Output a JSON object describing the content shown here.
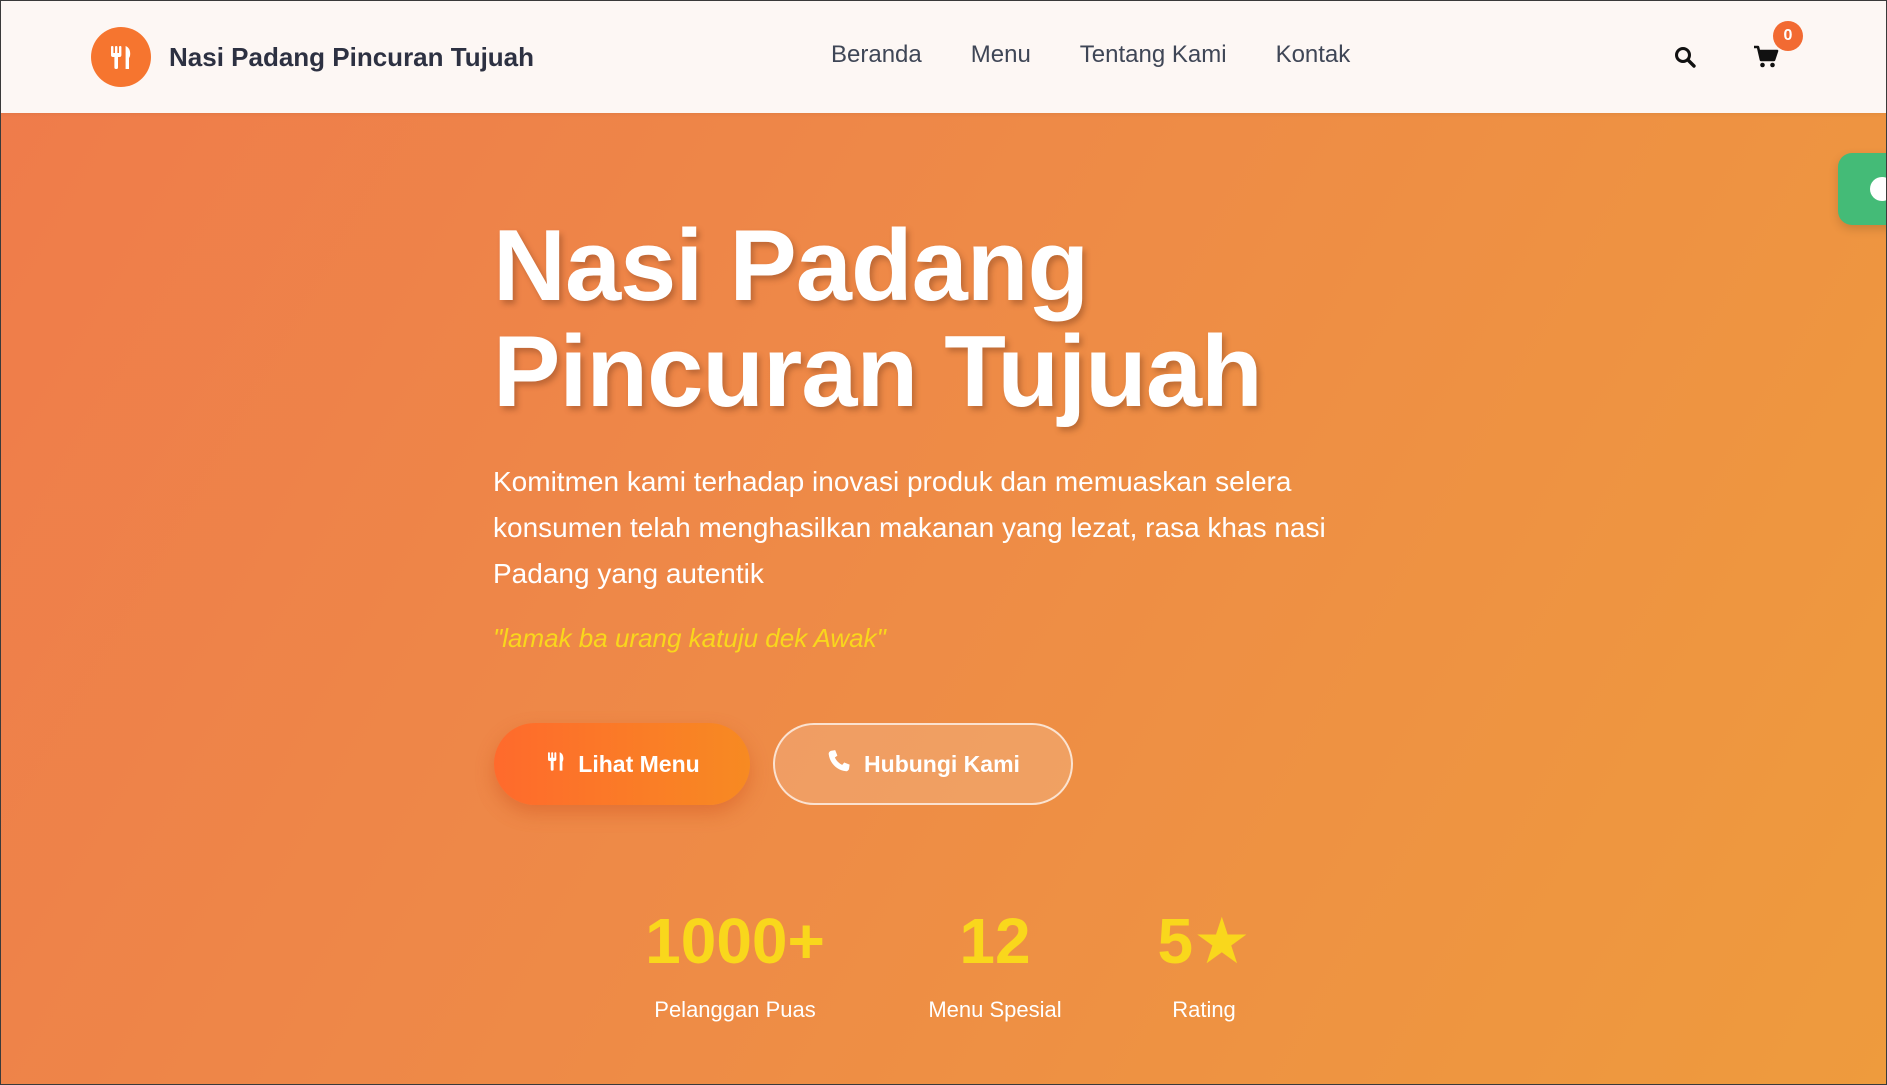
{
  "brand": {
    "name": "Nasi Padang Pincuran Tujuah",
    "logo_icon": "utensils-icon",
    "accent_color": "#f6752f"
  },
  "nav": {
    "links": [
      "Beranda",
      "Menu",
      "Tentang Kami",
      "Kontak"
    ],
    "search_icon": "search-icon",
    "cart_icon": "cart-icon",
    "cart_count": "0"
  },
  "hero": {
    "title_line1": "Nasi Padang",
    "title_line2": "Pincuran Tujuah",
    "description": "Komitmen kami terhadap inovasi produk dan memuaskan selera konsumen telah menghasilkan makanan yang lezat, rasa khas nasi Padang yang autentik",
    "quote": "\"lamak ba urang katuju dek Awak\"",
    "primary_button": "Lihat Menu",
    "secondary_button": "Hubungi Kami",
    "quote_color": "#f9d71c"
  },
  "stats": [
    {
      "value": "1000+",
      "label": "Pelanggan Puas"
    },
    {
      "value": "12",
      "label": "Menu Spesial"
    },
    {
      "value": "5★",
      "label": "Rating"
    }
  ],
  "floating_button": {
    "icon": "whatsapp-icon",
    "color": "#44bb77"
  }
}
